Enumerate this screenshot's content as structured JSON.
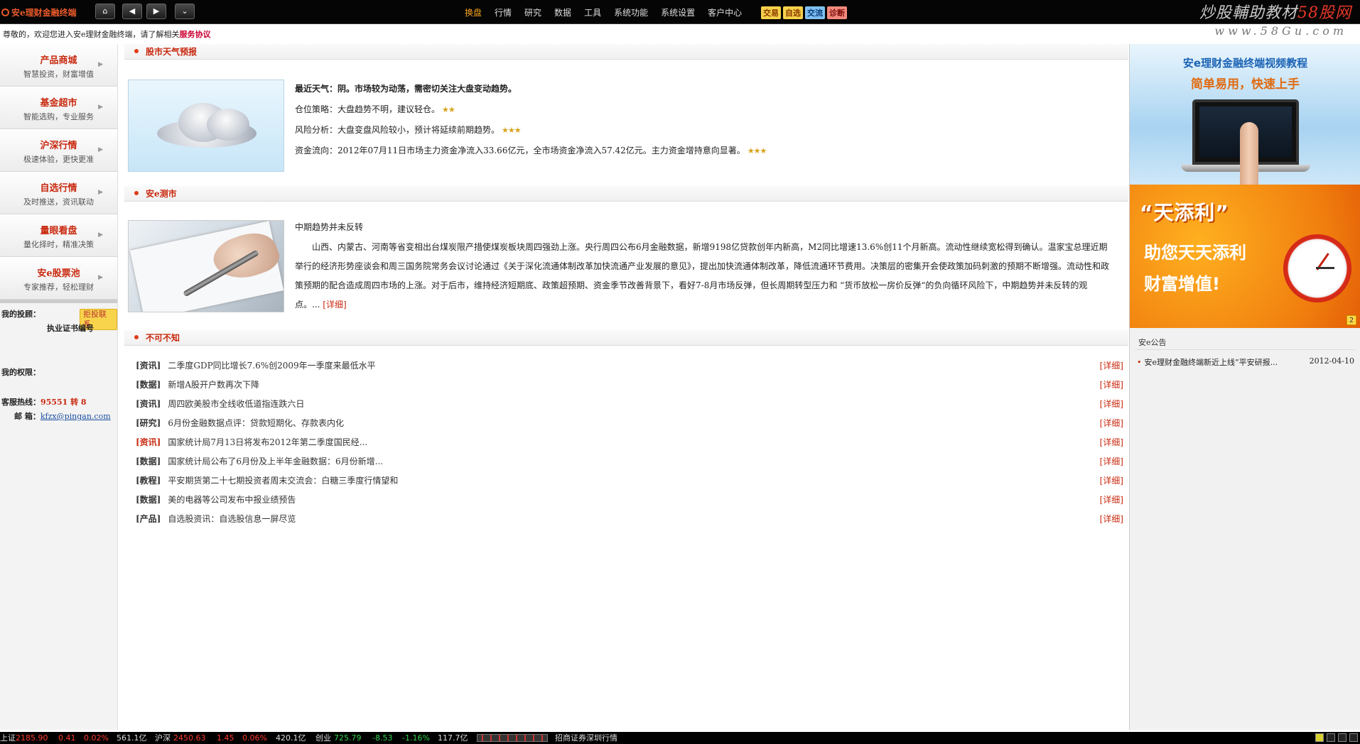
{
  "app": {
    "title": "安e理财金融终端"
  },
  "watermark": {
    "text_main": "炒股輔助教材",
    "text_hl": "58股网",
    "url": "www.58Gu.com"
  },
  "nav_buttons": {
    "home": "⌂",
    "back": "◀",
    "forward": "▶",
    "expand": "⌄"
  },
  "menu": [
    {
      "label": "换盘"
    },
    {
      "label": "行情"
    },
    {
      "label": "研究"
    },
    {
      "label": "数据"
    },
    {
      "label": "工具"
    },
    {
      "label": "系统功能"
    },
    {
      "label": "系统设置"
    },
    {
      "label": "客户中心"
    }
  ],
  "quick_buttons": [
    {
      "label": "交易",
      "bg": "#f6d24a",
      "color": "#8a3a00"
    },
    {
      "label": "自选",
      "bg": "#f6d24a",
      "color": "#8a3a00"
    },
    {
      "label": "交流",
      "bg": "#7fc0f0",
      "color": "#0a3a7a"
    },
    {
      "label": "诊断",
      "bg": "#f28b7d",
      "color": "#7a0a0a"
    }
  ],
  "welcome": {
    "text": "尊敬的，欢迎您进入安e理财金融终端，请了解相关",
    "link": "服务协议"
  },
  "sidebar": {
    "items": [
      {
        "title": "产品商城",
        "sub": "智慧投资，财富增值"
      },
      {
        "title": "基金超市",
        "sub": "智能选购，专业服务"
      },
      {
        "title": "沪深行情",
        "sub": "极速体验，更快更准"
      },
      {
        "title": "自选行情",
        "sub": "及时推送，资讯联动"
      },
      {
        "title": "量眼看盘",
        "sub": "量化择时，精准决策"
      },
      {
        "title": "安e股票池",
        "sub": "专家推荐，轻松理财"
      }
    ],
    "advisor_label": "我的投顾：",
    "complain_label": "拒投联系",
    "cert_label": "执业证书编号",
    "rights_label": "我的权限：",
    "hotline_label": "客服热线：",
    "hotline_value": "95551 转 8",
    "email_label": "邮  箱：",
    "email_value": "kfzx@pingan.com"
  },
  "weather": {
    "section_title": "股市天气预报",
    "rows": [
      {
        "label": "最近天气：",
        "text": "阴。市场较为动荡，需密切关注大盘变动趋势。",
        "stars": "",
        "bold": true
      },
      {
        "label": "仓位策略：",
        "text": "大盘趋势不明，建议轻仓。",
        "stars": "★★",
        "bold": false
      },
      {
        "label": "风险分析：",
        "text": "大盘变盘风险较小，预计将延续前期趋势。",
        "stars": "★★★",
        "bold": false
      },
      {
        "label": "资金流向：",
        "text": "2012年07月11日市场主力资金净流入33.66亿元，全市场资金净流入57.42亿元。主力资金增持意向显著。",
        "stars": "★★★",
        "bold": false
      }
    ]
  },
  "test": {
    "section_title": "安e测市",
    "article_title": "中期趋势并未反转",
    "article_body": "山西、内蒙古、河南等省变相出台煤炭限产措使煤炭板块周四强劲上涨。央行周四公布6月金融数据，新增9198亿贷款创年内新高，M2同比增速13.6%创11个月新高。流动性继续宽松得到确认。温家宝总理近期举行的经济形势座谈会和周三国务院常务会议讨论通过《关于深化流通体制改革加快流通产业发展的意见》，提出加快流通体制改革，降低流通环节费用。决策层的密集开会使政策加码刺激的预期不断增强。流动性和政策预期的配合造成周四市场的上涨。对于后市，维持经济短期底、政策超预期、资金季节改善背景下，看好7-8月市场反弹，但长周期转型压力和 “货币放松一房价反弹“的负向循环风险下，中期趋势并未反转的观点。...",
    "more": "[详细]"
  },
  "news": {
    "section_title": "不可不知",
    "more": "[详细]",
    "items": [
      {
        "cat": "[资讯]",
        "title": "二季度GDP同比增长7.6%创2009年一季度来最低水平",
        "red": false
      },
      {
        "cat": "[数据]",
        "title": "新增A股开户数再次下降",
        "red": false
      },
      {
        "cat": "[资讯]",
        "title": "周四欧美股市全线收低道指连跌六日",
        "red": false
      },
      {
        "cat": "[研究]",
        "title": "6月份金融数据点评：贷款短期化、存款表内化",
        "red": false
      },
      {
        "cat": "[资讯]",
        "title": "国家统计局7月13日将发布2012年第二季度国民经...",
        "red": true
      },
      {
        "cat": "[数据]",
        "title": "国家统计局公布了6月份及上半年金融数据：6月份新增...",
        "red": false
      },
      {
        "cat": "[教程]",
        "title": "平安期货第二十七期投资者周末交流会：白糖三季度行情望和",
        "red": false
      },
      {
        "cat": "[数据]",
        "title": "美的电器等公司发布中报业绩预告",
        "red": false
      },
      {
        "cat": "[产品]",
        "title": "自选股资讯：自选股信息一屏尽览",
        "red": false
      }
    ]
  },
  "right": {
    "ad1_title": "安e理财金融终端视频教程",
    "ad1_sub": "简单易用，快速上手",
    "ad2_title": "“天添利”",
    "ad2_line1": "助您天天添利",
    "ad2_line2": "财富增值!",
    "ad2_page": "2",
    "notice_title": "安e公告",
    "notice_item": "安e理财金融终端新近上线“平安研报...",
    "notice_date": "2012-04-10"
  },
  "ticker": {
    "sh_label": "上证",
    "sh_value": "2185.90",
    "sh_change": "0.41",
    "sh_pct": "0.02%",
    "sh_amount": "561.1亿",
    "hs_label": "沪深",
    "hs_value": "2450.63",
    "hs_change": "1.45",
    "hs_pct": "0.06%",
    "hs_amount": "420.1亿",
    "cy_label": "创业",
    "cy_value": "725.79",
    "cy_change": "-8.53",
    "cy_pct": "-1.16%",
    "cy_amount": "117.7亿",
    "broker_text": "招商证券深圳行情"
  }
}
